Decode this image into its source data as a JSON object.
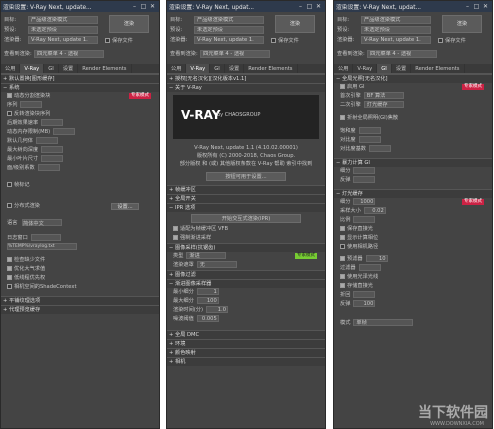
{
  "win1": {
    "title": "渲染设置: V-Ray Next, update...",
    "hdr": [
      {
        "l": "目标:",
        "v": "产品级渲染模式"
      },
      {
        "l": "预设:",
        "v": "未选定预设"
      },
      {
        "l": "渲染器:",
        "v": "V-Ray Next, update 1."
      },
      {
        "l": "查看到渲染:",
        "v": "四元菜单 4 - 透视"
      }
    ],
    "render_btn": "渲染",
    "save_file": "保存文件",
    "tabs": [
      "公用",
      "V-Ray",
      "GI",
      "设置",
      "Render Elements"
    ],
    "sections": [
      "默认置换[图形缓存]",
      "系统"
    ],
    "rows": [
      "动态分割渲染块",
      "序列",
      "反转渲染块序列",
      "后期效果速率",
      "动态内存限制(MB)",
      "默认几何体",
      "最大树向深度",
      "最小叶片尺寸",
      "面/级别系数",
      "帧标记",
      "分布式渲染",
      "语言",
      "日志窗口",
      "检查缺少文件",
      "优化大气求值",
      "低线程优先权",
      "相机空间的ShadeContext",
      "平铺纹理选项",
      "代理预览缓存"
    ],
    "labels": {
      "tag": "专家模式",
      "lang": "简体中文",
      "settings": "设置...",
      "log": "%TEMP%\\vraylog.txt"
    }
  },
  "win2": {
    "title": "渲染设置: V-Ray Next, updat...",
    "sections": [
      "授权[无名汉化][汉化版本v1.1]",
      "关于 V-Ray",
      "帧缓冲区",
      "全局开关",
      "IPR 选项",
      "图像采样(抗锯齿)",
      "图像过滤",
      "渐进图像采样器",
      "全局 DMC",
      "环境",
      "颜色映射",
      "相机"
    ],
    "logo": "V-RAY",
    "chaos": "by CHAOSGROUP",
    "info": [
      "V-Ray Next, update 1.1 (4.10.02.00001)",
      "版权所有 (C) 2000-2018, Chaos Group.",
      "部分版权 和 (或) 其他版权条款在 V-Ray 帮助 索引中找到",
      "按钮可用于设置..."
    ],
    "ipr_btn": "开始交互式渲染(IPR)",
    "ipr_rows": [
      "适配为帧缓冲区 VFB",
      "强制渐进采样"
    ],
    "aa_rows": [
      {
        "l": "类型",
        "v": "渐进"
      },
      {
        "l": "渲染遮罩",
        "v": "无"
      }
    ],
    "prog_rows": [
      {
        "l": "最小细分",
        "v": "1"
      },
      {
        "l": "最大细分",
        "v": "100"
      },
      {
        "l": "渲染时间(分)",
        "v": "1.0"
      },
      {
        "l": "噪波阈值",
        "v": "0.005"
      }
    ]
  },
  "win3": {
    "title": "渲染设置: V-Ray Next, updat...",
    "tabs": [
      "公用",
      "V-Ray",
      "GI",
      "设置",
      "Render Elements"
    ],
    "sections": [
      "全局光照[无名汉化]",
      "暴力计算 GI",
      "灯光缓存"
    ],
    "gi_rows": [
      "启用 GI",
      "首次引擎",
      "二次引擎",
      "折射全局照明(GI)焦散",
      "饱和度",
      "对比度",
      "对比度基数"
    ],
    "bf_rows": [
      "细分",
      "反弹"
    ],
    "lc_rows": [
      "细分",
      "采样大小",
      "比例",
      "保存直接光",
      "显示计算相位",
      "使用相机路径",
      "预滤器",
      "过滤器",
      "使用光泽光线",
      "存储直接光",
      "折回",
      "反弹"
    ],
    "labels": {
      "brute": "BF 算法",
      "lightcache": "灯光缓存",
      "mode": "模式",
      "single": "单帧",
      "tag": "专家模式",
      "val1000": "1000",
      "val002": "0.02",
      "val10": "10",
      "val100": "100"
    },
    "watermark": "当下软件园",
    "wm_url": "WWW.DOWNXIA.COM"
  }
}
